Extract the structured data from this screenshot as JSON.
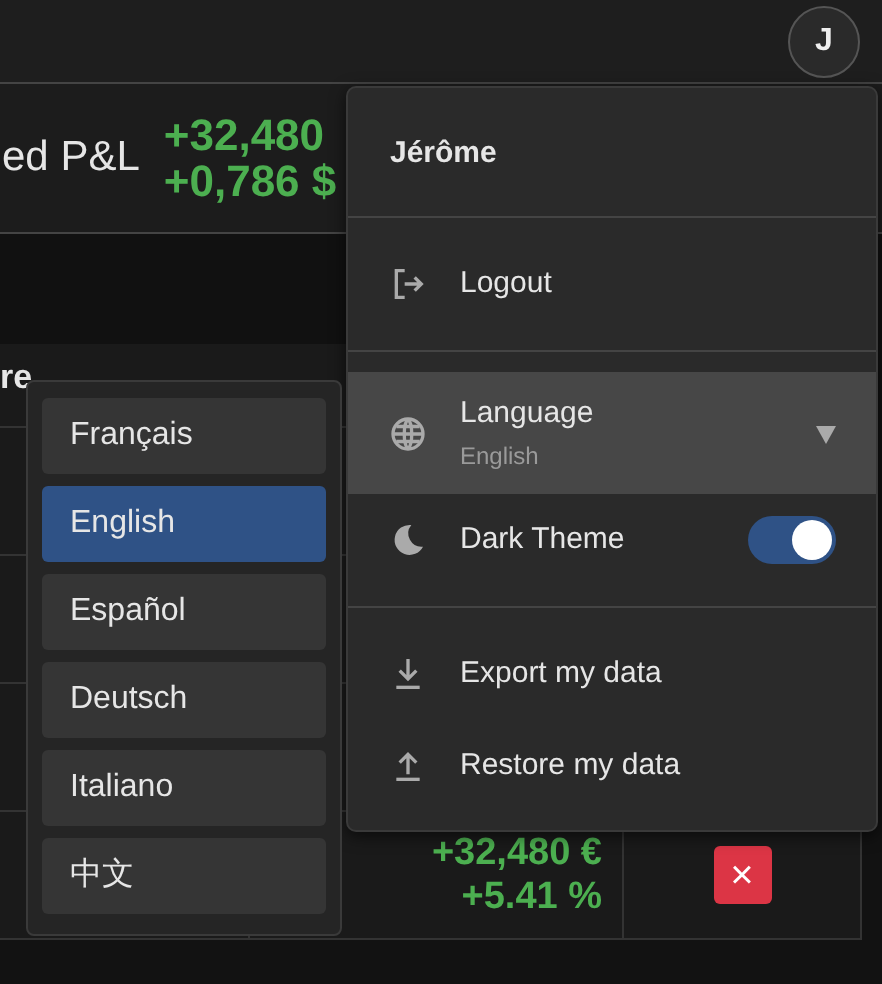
{
  "navbar": {
    "avatar": "J"
  },
  "summary": {
    "label": "ed P&L",
    "values": [
      "+32,480",
      "+0,786 $"
    ]
  },
  "table": {
    "header": "re",
    "rows": [
      {
        "pnl": "",
        "pct": ""
      },
      {
        "pnl": "",
        "pct": ""
      },
      {
        "pnl": "",
        "pct": ""
      },
      {
        "pnl": "+32,480 €",
        "pct": "+5.41 %",
        "delete": "×"
      }
    ]
  },
  "user_menu": {
    "name": "Jérôme",
    "sections": [
      [
        {
          "kind": "action",
          "label": "Logout"
        }
      ],
      [
        {
          "kind": "select",
          "label": "Language",
          "value": "English",
          "expanded": true
        },
        {
          "kind": "toggle",
          "label": "Dark Theme",
          "on": true
        }
      ],
      [
        {
          "kind": "action",
          "label": "Export my data"
        },
        {
          "kind": "action",
          "label": "Restore my data"
        }
      ]
    ]
  },
  "languages": [
    {
      "label": "Français",
      "selected": false
    },
    {
      "label": "English",
      "selected": true
    },
    {
      "label": "Español",
      "selected": false
    },
    {
      "label": "Deutsch",
      "selected": false
    },
    {
      "label": "Italiano",
      "selected": false
    },
    {
      "label": "中文",
      "selected": false
    }
  ]
}
